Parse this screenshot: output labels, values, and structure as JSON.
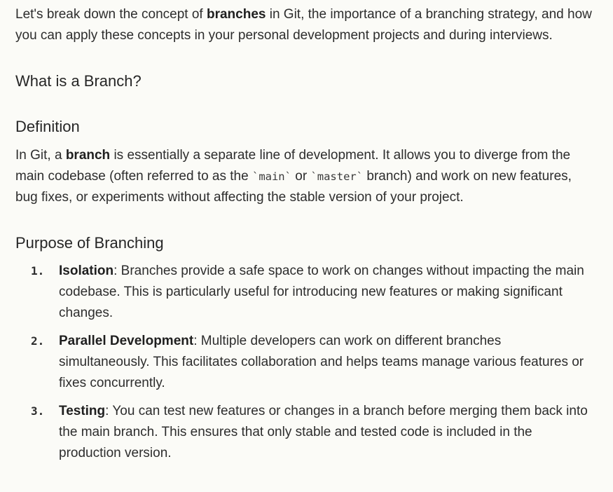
{
  "intro": {
    "before": "Let's break down the concept of ",
    "bold": "branches",
    "after": " in Git, the importance of a branching strategy, and how you can apply these concepts in your personal development projects and during interviews."
  },
  "section_what": {
    "heading": "What is a Branch?"
  },
  "definition": {
    "heading": "Definition",
    "before": "In Git, a ",
    "bold": "branch",
    "mid1": " is essentially a separate line of development. It allows you to diverge from the main codebase (often referred to as the ",
    "code1": "`main`",
    "mid2": " or ",
    "code2": "`master`",
    "after": " branch) and work on new features, bug fixes, or experiments without affecting the stable version of your project."
  },
  "purpose": {
    "heading": "Purpose of Branching",
    "items": [
      {
        "number": "1.",
        "term": "Isolation",
        "text": ": Branches provide a safe space to work on changes without impacting the main codebase. This is particularly useful for introducing new features or making significant changes."
      },
      {
        "number": "2.",
        "term": "Parallel Development",
        "text": ": Multiple developers can work on different branches simultaneously. This facilitates collaboration and helps teams manage various features or fixes concurrently."
      },
      {
        "number": "3.",
        "term": "Testing",
        "text": ": You can test new features or changes in a branch before merging them back into the main branch. This ensures that only stable and tested code is included in the production version."
      }
    ]
  }
}
